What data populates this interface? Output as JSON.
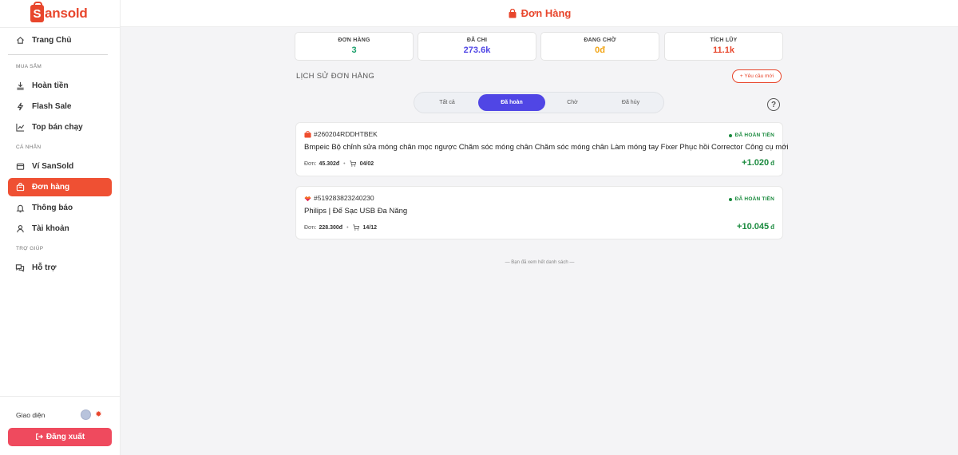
{
  "brand": {
    "logo_letter": "S",
    "logo_text": "ansold",
    "color": "#e8462c"
  },
  "header": {
    "title": "Đơn Hàng",
    "icon": "shopping-bag-icon"
  },
  "sidebar": {
    "home": {
      "label": "Trang Chủ",
      "icon": "home-icon"
    },
    "section_shopping": "MUA SẮM",
    "refund": {
      "label": "Hoàn tiền",
      "icon": "refund-icon"
    },
    "flash_sale": {
      "label": "Flash Sale",
      "icon": "lightning-icon"
    },
    "top_selling": {
      "label": "Top bán chạy",
      "icon": "trending-icon"
    },
    "section_personal": "CÁ NHÂN",
    "wallet": {
      "label": "Ví SanSold",
      "icon": "wallet-icon"
    },
    "orders": {
      "label": "Đơn hàng",
      "icon": "bag-icon",
      "active": true
    },
    "notifications": {
      "label": "Thông báo",
      "icon": "bell-icon"
    },
    "account": {
      "label": "Tài khoản",
      "icon": "user-icon"
    },
    "section_help": "TRỢ GIÚP",
    "support": {
      "label": "Hỗ trợ",
      "icon": "chat-icon"
    },
    "theme_label": "Giao diện",
    "logout": {
      "label": "Đăng xuất",
      "icon": "logout-icon"
    }
  },
  "stats": [
    {
      "label": "ĐƠN HÀNG",
      "value": "3",
      "color": "#1a9f6a"
    },
    {
      "label": "ĐÃ CHI",
      "value": "273.6k",
      "color": "#5046e5"
    },
    {
      "label": "ĐANG CHỜ",
      "value": "0đ",
      "color": "#f2a516"
    },
    {
      "label": "TÍCH LŨY",
      "value": "11.1k",
      "color": "#e8462c"
    }
  ],
  "history": {
    "title": "LỊCH SỬ ĐƠN HÀNG",
    "new_request": "+ Yêu cầu mới"
  },
  "tabs": [
    {
      "label": "Tất cả",
      "active": false
    },
    {
      "label": "Đã hoàn",
      "active": true
    },
    {
      "label": "Chờ",
      "active": false
    },
    {
      "label": "Đã hủy",
      "active": false
    }
  ],
  "orders": [
    {
      "shop_icon": "shopee-icon",
      "id": "#260204RDDHTBEK",
      "status": "ĐÃ HOÀN TIỀN",
      "name": "Bmpeic Bộ chỉnh sửa móng chân mọc ngược Chăm sóc móng chân Chăm sóc móng chân Làm móng tay Fixer Phục hồi Corrector Công cụ mới",
      "price_label": "Đơn:",
      "price": "45.302đ",
      "date": "04/02",
      "amount": "+1.020",
      "currency": "đ"
    },
    {
      "shop_icon": "lazada-icon",
      "id": "#519283823240230",
      "status": "ĐÃ HOÀN TIỀN",
      "name": "Philips | Đế Sạc USB Đa Năng",
      "price_label": "Đơn:",
      "price": "228.300đ",
      "date": "14/12",
      "amount": "+10.045",
      "currency": "đ"
    }
  ],
  "end_note": "— Bạn đã xem hết danh sách —"
}
